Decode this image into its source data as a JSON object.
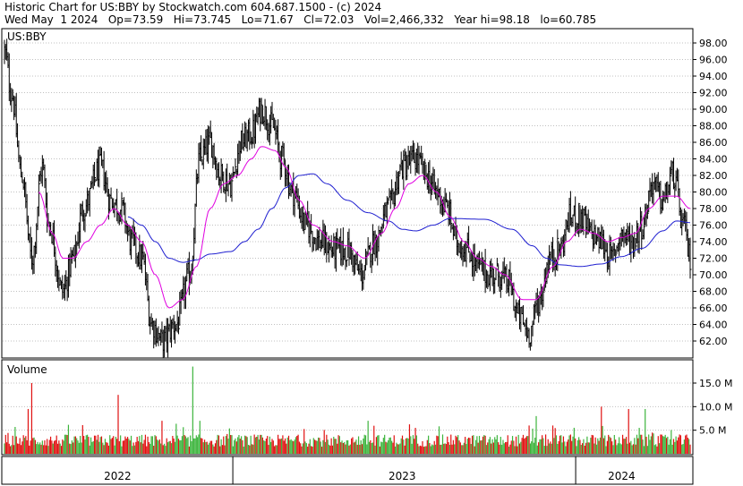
{
  "header": {
    "line1": "Historic Chart for US:BBY by Stockwatch.com 604.687.1500 - (c) 2024",
    "line2": "Wed May  1 2024   Op=73.59   Hi=73.745   Lo=71.67   Cl=72.03   Vol=2,466,332   Year hi=98.18   lo=60.785"
  },
  "colors": {
    "background": "#ffffff",
    "price_bar": "#000000",
    "ma_short": "#e000e0",
    "ma_long": "#1f1fd0",
    "volume_up": "#3cb43c",
    "volume_down": "#e01010",
    "grid": "#c0c0c0"
  },
  "chart_data": [
    {
      "type": "ohlc",
      "title": "US:BBY",
      "y_ticks": [
        "98.00",
        "96.00",
        "94.00",
        "92.00",
        "90.00",
        "88.00",
        "86.00",
        "84.00",
        "82.00",
        "80.00",
        "78.00",
        "76.00",
        "74.00",
        "72.00",
        "70.00",
        "68.00",
        "66.00",
        "64.00",
        "62.00"
      ],
      "ylim": [
        60,
        99
      ],
      "x_labels": [
        "2022",
        "2023",
        "2024"
      ],
      "grid": true,
      "anchors": [
        {
          "t": 0.0,
          "v": 97
        },
        {
          "t": 0.01,
          "v": 92
        },
        {
          "t": 0.025,
          "v": 82
        },
        {
          "t": 0.04,
          "v": 72
        },
        {
          "t": 0.055,
          "v": 83
        },
        {
          "t": 0.065,
          "v": 76
        },
        {
          "t": 0.085,
          "v": 68
        },
        {
          "t": 0.1,
          "v": 72
        },
        {
          "t": 0.115,
          "v": 78
        },
        {
          "t": 0.14,
          "v": 83
        },
        {
          "t": 0.155,
          "v": 79
        },
        {
          "t": 0.17,
          "v": 78
        },
        {
          "t": 0.185,
          "v": 74
        },
        {
          "t": 0.2,
          "v": 72
        },
        {
          "t": 0.215,
          "v": 64
        },
        {
          "t": 0.23,
          "v": 62
        },
        {
          "t": 0.25,
          "v": 64
        },
        {
          "t": 0.27,
          "v": 70
        },
        {
          "t": 0.285,
          "v": 84
        },
        {
          "t": 0.3,
          "v": 86
        },
        {
          "t": 0.315,
          "v": 82
        },
        {
          "t": 0.33,
          "v": 81
        },
        {
          "t": 0.345,
          "v": 86
        },
        {
          "t": 0.36,
          "v": 87
        },
        {
          "t": 0.375,
          "v": 90
        },
        {
          "t": 0.39,
          "v": 88
        },
        {
          "t": 0.405,
          "v": 84
        },
        {
          "t": 0.42,
          "v": 80
        },
        {
          "t": 0.44,
          "v": 76
        },
        {
          "t": 0.46,
          "v": 74
        },
        {
          "t": 0.48,
          "v": 73
        },
        {
          "t": 0.5,
          "v": 73
        },
        {
          "t": 0.52,
          "v": 70
        },
        {
          "t": 0.54,
          "v": 74
        },
        {
          "t": 0.56,
          "v": 78
        },
        {
          "t": 0.58,
          "v": 83
        },
        {
          "t": 0.6,
          "v": 84
        },
        {
          "t": 0.615,
          "v": 82
        },
        {
          "t": 0.63,
          "v": 80
        },
        {
          "t": 0.645,
          "v": 78
        },
        {
          "t": 0.66,
          "v": 74
        },
        {
          "t": 0.675,
          "v": 73
        },
        {
          "t": 0.69,
          "v": 71
        },
        {
          "t": 0.705,
          "v": 70
        },
        {
          "t": 0.72,
          "v": 70
        },
        {
          "t": 0.735,
          "v": 69
        },
        {
          "t": 0.75,
          "v": 65
        },
        {
          "t": 0.765,
          "v": 63
        },
        {
          "t": 0.78,
          "v": 67
        },
        {
          "t": 0.795,
          "v": 72
        },
        {
          "t": 0.81,
          "v": 73
        },
        {
          "t": 0.825,
          "v": 77
        },
        {
          "t": 0.84,
          "v": 77
        },
        {
          "t": 0.855,
          "v": 75
        },
        {
          "t": 0.87,
          "v": 74
        },
        {
          "t": 0.885,
          "v": 72
        },
        {
          "t": 0.9,
          "v": 75
        },
        {
          "t": 0.915,
          "v": 74
        },
        {
          "t": 0.93,
          "v": 76
        },
        {
          "t": 0.945,
          "v": 81
        },
        {
          "t": 0.96,
          "v": 79
        },
        {
          "t": 0.975,
          "v": 82
        },
        {
          "t": 0.99,
          "v": 76
        },
        {
          "t": 1.0,
          "v": 72
        }
      ],
      "ma_short_anchors": [
        {
          "t": 0.05,
          "v": 80
        },
        {
          "t": 0.07,
          "v": 75
        },
        {
          "t": 0.085,
          "v": 72
        },
        {
          "t": 0.1,
          "v": 72
        },
        {
          "t": 0.12,
          "v": 74
        },
        {
          "t": 0.14,
          "v": 76
        },
        {
          "t": 0.16,
          "v": 78
        },
        {
          "t": 0.18,
          "v": 76
        },
        {
          "t": 0.2,
          "v": 74
        },
        {
          "t": 0.22,
          "v": 70
        },
        {
          "t": 0.24,
          "v": 66
        },
        {
          "t": 0.26,
          "v": 67
        },
        {
          "t": 0.28,
          "v": 71
        },
        {
          "t": 0.3,
          "v": 78
        },
        {
          "t": 0.32,
          "v": 81
        },
        {
          "t": 0.34,
          "v": 82
        },
        {
          "t": 0.36,
          "v": 84
        },
        {
          "t": 0.375,
          "v": 85.5
        },
        {
          "t": 0.395,
          "v": 85
        },
        {
          "t": 0.41,
          "v": 83
        },
        {
          "t": 0.43,
          "v": 79
        },
        {
          "t": 0.45,
          "v": 76
        },
        {
          "t": 0.48,
          "v": 74
        },
        {
          "t": 0.5,
          "v": 73.5
        },
        {
          "t": 0.525,
          "v": 72
        },
        {
          "t": 0.55,
          "v": 75
        },
        {
          "t": 0.57,
          "v": 78
        },
        {
          "t": 0.59,
          "v": 81
        },
        {
          "t": 0.61,
          "v": 82
        },
        {
          "t": 0.63,
          "v": 80
        },
        {
          "t": 0.65,
          "v": 77
        },
        {
          "t": 0.67,
          "v": 74
        },
        {
          "t": 0.69,
          "v": 72
        },
        {
          "t": 0.71,
          "v": 71
        },
        {
          "t": 0.73,
          "v": 70
        },
        {
          "t": 0.755,
          "v": 67
        },
        {
          "t": 0.775,
          "v": 67
        },
        {
          "t": 0.8,
          "v": 71
        },
        {
          "t": 0.82,
          "v": 74
        },
        {
          "t": 0.84,
          "v": 75.5
        },
        {
          "t": 0.86,
          "v": 75
        },
        {
          "t": 0.88,
          "v": 74
        },
        {
          "t": 0.9,
          "v": 74.5
        },
        {
          "t": 0.92,
          "v": 75
        },
        {
          "t": 0.94,
          "v": 78
        },
        {
          "t": 0.96,
          "v": 79.5
        },
        {
          "t": 0.98,
          "v": 79.5
        },
        {
          "t": 1.0,
          "v": 78
        }
      ],
      "ma_long_anchors": [
        {
          "t": 0.18,
          "v": 77
        },
        {
          "t": 0.2,
          "v": 76
        },
        {
          "t": 0.22,
          "v": 74
        },
        {
          "t": 0.24,
          "v": 72
        },
        {
          "t": 0.26,
          "v": 71.5
        },
        {
          "t": 0.28,
          "v": 71.8
        },
        {
          "t": 0.3,
          "v": 72.5
        },
        {
          "t": 0.33,
          "v": 72.8
        },
        {
          "t": 0.35,
          "v": 74
        },
        {
          "t": 0.37,
          "v": 75.5
        },
        {
          "t": 0.39,
          "v": 78
        },
        {
          "t": 0.41,
          "v": 80.5
        },
        {
          "t": 0.43,
          "v": 82
        },
        {
          "t": 0.45,
          "v": 82.2
        },
        {
          "t": 0.47,
          "v": 81
        },
        {
          "t": 0.5,
          "v": 79
        },
        {
          "t": 0.53,
          "v": 77.5
        },
        {
          "t": 0.56,
          "v": 76.5
        },
        {
          "t": 0.58,
          "v": 75.5
        },
        {
          "t": 0.6,
          "v": 75.3
        },
        {
          "t": 0.625,
          "v": 76
        },
        {
          "t": 0.65,
          "v": 76.8
        },
        {
          "t": 0.7,
          "v": 76.7
        },
        {
          "t": 0.74,
          "v": 75.5
        },
        {
          "t": 0.77,
          "v": 73.5
        },
        {
          "t": 0.79,
          "v": 72
        },
        {
          "t": 0.81,
          "v": 71.2
        },
        {
          "t": 0.84,
          "v": 71
        },
        {
          "t": 0.87,
          "v": 71.3
        },
        {
          "t": 0.9,
          "v": 72.2
        },
        {
          "t": 0.93,
          "v": 73.2
        },
        {
          "t": 0.96,
          "v": 75.3
        },
        {
          "t": 0.98,
          "v": 76.5
        },
        {
          "t": 1.0,
          "v": 76.3
        }
      ]
    },
    {
      "type": "bar",
      "title": "Volume",
      "y_ticks": [
        "15.0 M",
        "10.0 M",
        "5.0 M"
      ],
      "ylim": [
        0,
        19.5
      ],
      "volume_spikes": [
        {
          "t": 0.04,
          "v": 15
        },
        {
          "t": 0.035,
          "v": 9.5
        },
        {
          "t": 0.165,
          "v": 12.5
        },
        {
          "t": 0.23,
          "v": 7
        },
        {
          "t": 0.275,
          "v": 18.5
        },
        {
          "t": 0.285,
          "v": 7
        },
        {
          "t": 0.53,
          "v": 7
        },
        {
          "t": 0.6,
          "v": 5.5
        },
        {
          "t": 0.775,
          "v": 8
        },
        {
          "t": 0.765,
          "v": 6
        },
        {
          "t": 0.8,
          "v": 6
        },
        {
          "t": 0.87,
          "v": 10
        },
        {
          "t": 0.91,
          "v": 9.5
        },
        {
          "t": 0.935,
          "v": 9.5
        },
        {
          "t": 0.925,
          "v": 5.5
        },
        {
          "t": 0.945,
          "v": 4.5
        }
      ]
    }
  ]
}
